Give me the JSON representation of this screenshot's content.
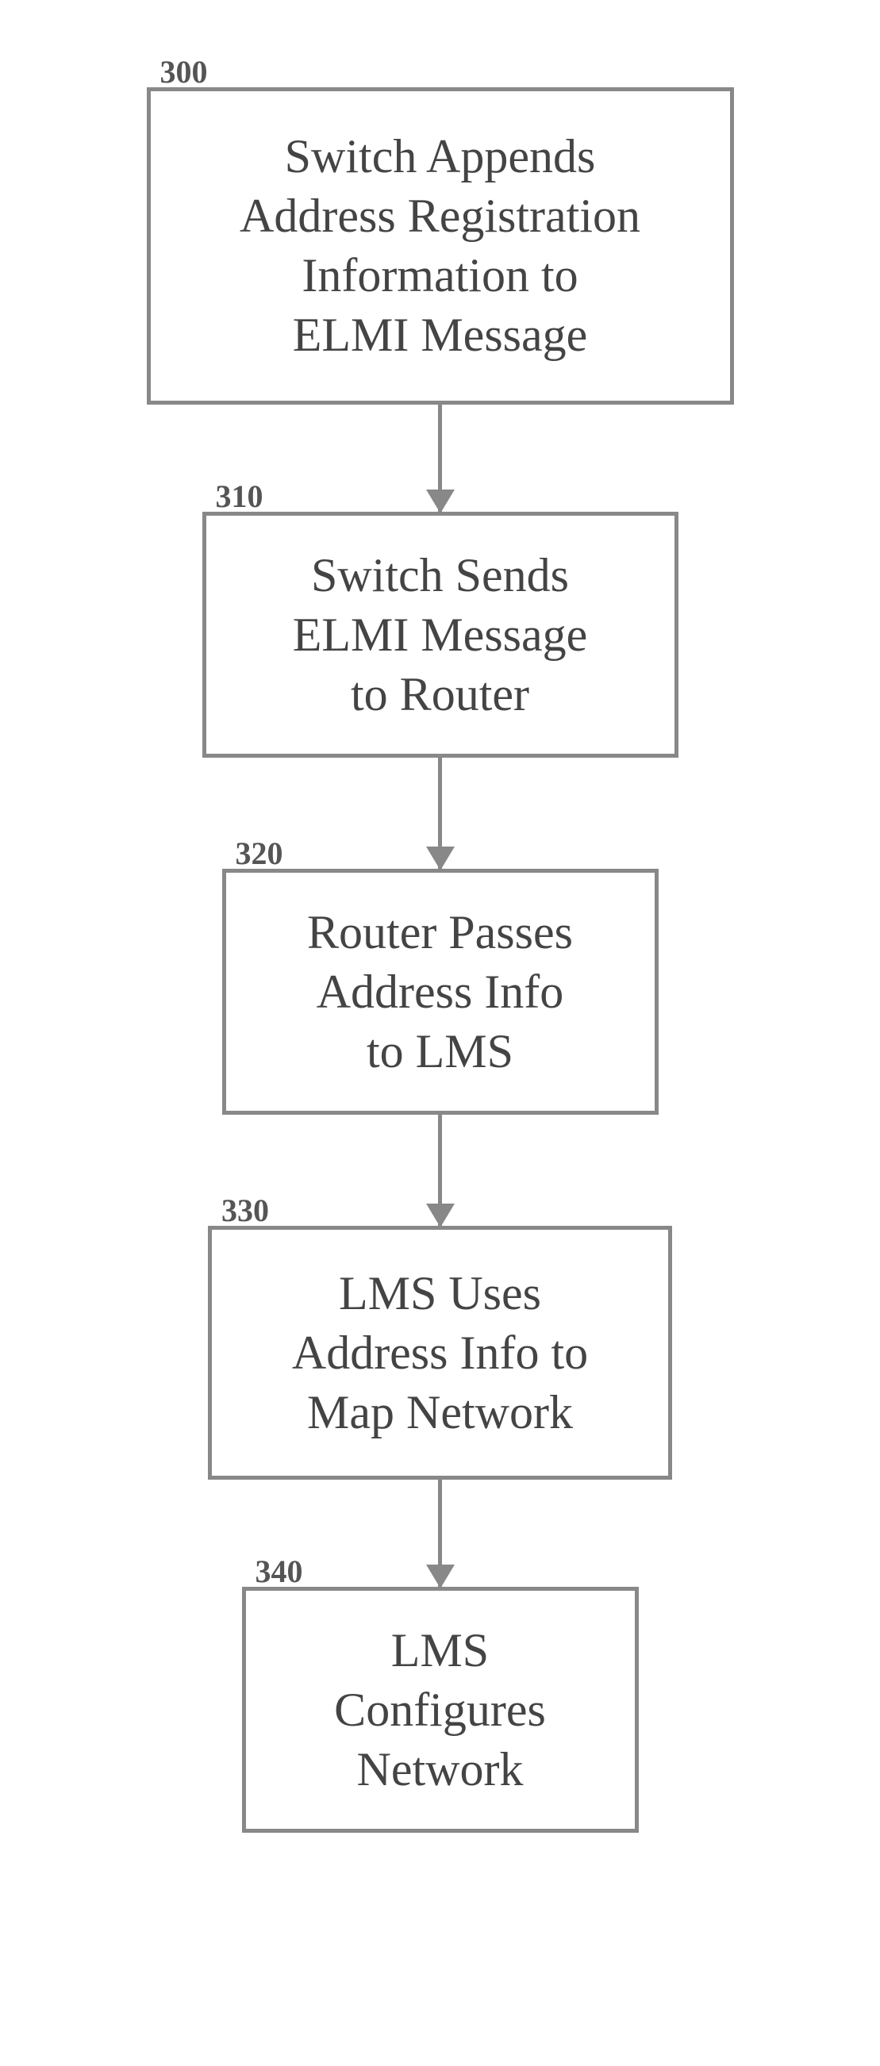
{
  "flow": {
    "nodes": [
      {
        "id": "300",
        "text": "Switch Appends\nAddress Registration\nInformation to\nELMI Message"
      },
      {
        "id": "310",
        "text": "Switch Sends\nELMI Message\nto Router"
      },
      {
        "id": "320",
        "text": "Router Passes\nAddress Info\nto LMS"
      },
      {
        "id": "330",
        "text": "LMS Uses\nAddress Info to\nMap Network"
      },
      {
        "id": "340",
        "text": "LMS\nConfigures\nNetwork"
      }
    ]
  }
}
